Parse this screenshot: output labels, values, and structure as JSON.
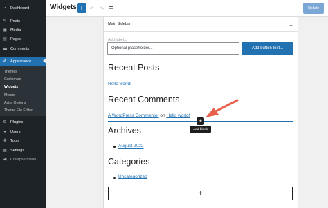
{
  "admin_menu": {
    "items": [
      {
        "label": "Dashboard",
        "icon": "dashboard-icon"
      },
      {
        "label": "Posts",
        "icon": "pin-icon"
      },
      {
        "label": "Media",
        "icon": "media-icon"
      },
      {
        "label": "Pages",
        "icon": "pages-icon"
      },
      {
        "label": "Comments",
        "icon": "comments-icon"
      },
      {
        "label": "Appearance",
        "icon": "brush-icon"
      },
      {
        "label": "Plugins",
        "icon": "plugins-icon"
      },
      {
        "label": "Users",
        "icon": "users-icon"
      },
      {
        "label": "Tools",
        "icon": "tools-icon"
      },
      {
        "label": "Settings",
        "icon": "settings-icon"
      },
      {
        "label": "Collapse menu",
        "icon": "collapse-icon"
      }
    ],
    "submenu": [
      "Themes",
      "Customize",
      "Widgets",
      "Menus",
      "Astra Options",
      "Theme File Editor"
    ],
    "current_submenu": "Widgets",
    "colors": {
      "bg": "#1d2327",
      "active": "#2271b1",
      "submenu_bg": "#2c3338"
    }
  },
  "header": {
    "title": "Widgets",
    "inserter_label": "+",
    "undo_icon": "undo-icon",
    "redo_icon": "redo-icon",
    "list_view_icon": "list-view-icon",
    "update_label": "Update"
  },
  "widget_area": {
    "title": "Main Sidebar",
    "chevron_icon": "chevron-up-icon",
    "search": {
      "label_placeholder": "Add label...",
      "input_placeholder": "Optional placeholder...",
      "button_label": "Add button text..."
    },
    "recent_posts": {
      "heading": "Recent Posts",
      "items": [
        "Hello world!"
      ]
    },
    "recent_comments": {
      "heading": "Recent Comments",
      "author": "A WordPress Commenter",
      "on": "on",
      "post": "Hello world!"
    },
    "inserter": {
      "label": "+",
      "tooltip": "Add block"
    },
    "archives": {
      "heading": "Archives",
      "items": [
        "August 2022"
      ]
    },
    "categories": {
      "heading": "Categories",
      "items": [
        "Uncategorized"
      ]
    },
    "appender_label": "+"
  },
  "colors": {
    "accent": "#2271b1",
    "annotation_arrow": "#e8604c"
  }
}
